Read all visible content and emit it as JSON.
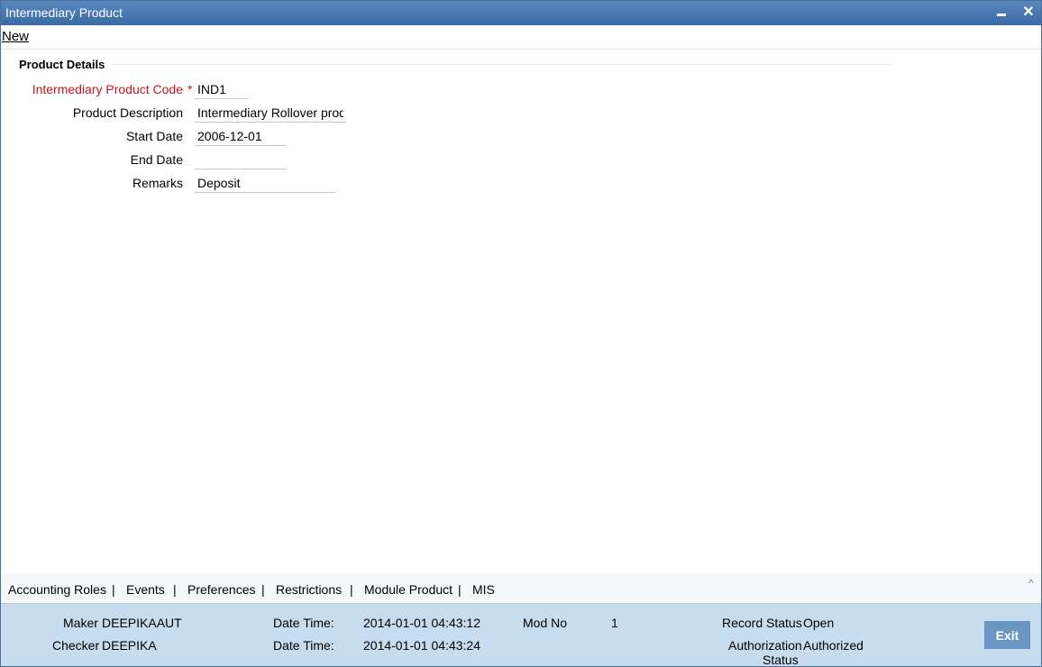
{
  "window": {
    "title": "Intermediary Product"
  },
  "toolbar": {
    "new_label": "New"
  },
  "section": {
    "title": "Product Details"
  },
  "fields": {
    "product_code": {
      "label": "Intermediary Product Code",
      "required_mark": "*",
      "value": "IND1"
    },
    "description": {
      "label": "Product Description",
      "value": "Intermediary Rollover product"
    },
    "start_date": {
      "label": "Start Date",
      "value": "2006-12-01"
    },
    "end_date": {
      "label": "End Date",
      "value": ""
    },
    "remarks": {
      "label": "Remarks",
      "value": "Deposit"
    }
  },
  "tabs": [
    "Accounting Roles",
    "Events",
    "Preferences",
    "Restrictions",
    "Module Product",
    "MIS"
  ],
  "tab_separator": "|",
  "footer": {
    "maker_label": "Maker",
    "maker_value": "DEEPIKAAUT",
    "checker_label": "Checker",
    "checker_value": "DEEPIKA",
    "datetime_label": "Date Time:",
    "maker_datetime": "2014-01-01 04:43:12",
    "checker_datetime": "2014-01-01 04:43:24",
    "modno_label": "Mod No",
    "modno_value": "1",
    "record_status_label": "Record Status",
    "record_status_value": "Open",
    "auth_status_label_1": "Authorization",
    "auth_status_label_2": "Status",
    "auth_status_value": "Authorized",
    "exit_label": "Exit"
  },
  "colors": {
    "titlebar": "#3a6aa5",
    "required": "#c4161c",
    "footer": "#c7ddef",
    "exit_button": "#6b95c2"
  },
  "icons": {
    "minimize": "minimize-icon",
    "close": "close-icon",
    "collapse": "chevron-up-icon"
  }
}
